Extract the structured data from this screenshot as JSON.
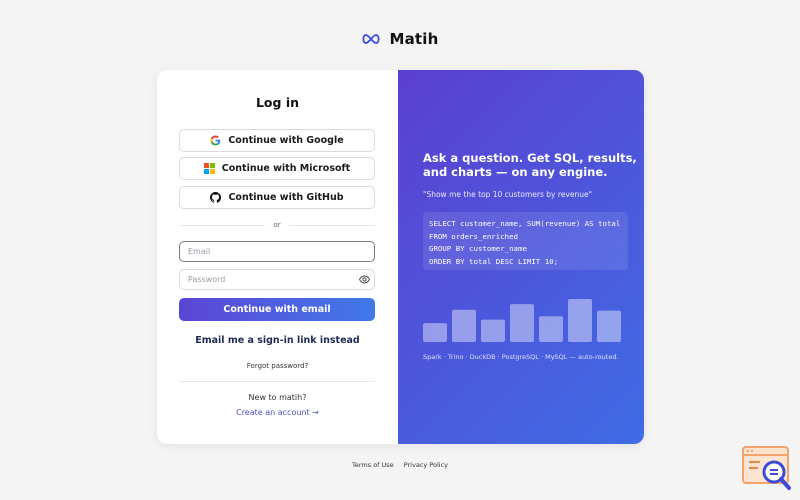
{
  "brand": {
    "name": "Matih",
    "logo_icon": "infinity-logo-icon",
    "logo_color": "#3b4bd8"
  },
  "login": {
    "title": "Log in",
    "sso": {
      "google_label": "Continue with Google",
      "microsoft_label": "Continue with Microsoft",
      "github_label": "Continue with GitHub"
    },
    "divider_text": "or",
    "email_placeholder": "Email",
    "password_placeholder": "Password",
    "submit_label": "Continue with email",
    "magic_link_label": "Email me a sign-in link instead",
    "forgot_label": "Forgot password?",
    "new_user_text": "New to matih?",
    "create_account_label": "Create an account →"
  },
  "promo": {
    "headline": "Ask a question. Get SQL, results, and charts — on any engine.",
    "example_prompt": "\"Show me the top 10 customers by revenue\"",
    "sql_lines": [
      "SELECT customer_name, SUM(revenue) AS total",
      "FROM orders_enriched",
      "GROUP BY customer_name",
      "ORDER BY total DESC LIMIT 10;"
    ],
    "chart_bar_levels": [
      0.44,
      0.75,
      0.52,
      0.88,
      0.6,
      1.0,
      0.73
    ],
    "engines_text": "Spark · Trino · DuckDB · PostgreSQL · MySQL — auto-routed.",
    "gradient_colors": [
      "#5b3fd0",
      "#3f6ce6"
    ]
  },
  "footer": {
    "terms_label": "Terms of Use",
    "privacy_label": "Privacy Policy"
  },
  "colors": {
    "primary_button": "#4e62e0",
    "link": "#4a4fc8",
    "help_widget": "#f0a36b"
  }
}
